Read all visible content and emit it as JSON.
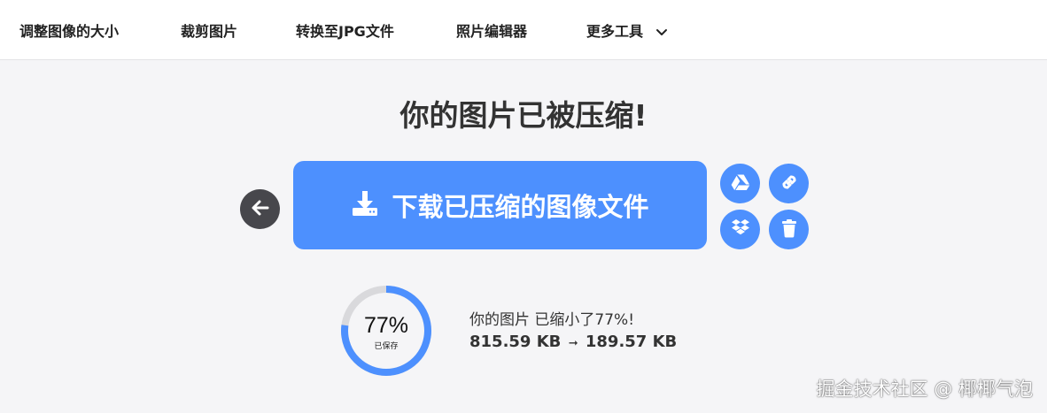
{
  "nav": {
    "items": [
      {
        "label": "调整图像的大小"
      },
      {
        "label": "裁剪图片"
      },
      {
        "label": "转换至JPG文件"
      },
      {
        "label": "照片编辑器"
      },
      {
        "label": "更多工具"
      }
    ],
    "more_icon": "chevron-down-icon"
  },
  "main": {
    "headline": "你的图片已被压缩!",
    "download_label": "下载已压缩的图像文件",
    "download_icon": "download-tray-icon",
    "back_icon": "arrow-left-icon",
    "actions": [
      {
        "icon": "google-drive-icon"
      },
      {
        "icon": "link-icon"
      },
      {
        "icon": "dropbox-icon"
      },
      {
        "icon": "trash-icon"
      }
    ]
  },
  "result": {
    "percent_saved_label": "77%",
    "percent_saved_value": 0.77,
    "saved_label": "已保存",
    "message": "你的图片 已缩小了77%!",
    "original_size": "815.59 KB",
    "arrow": "➞",
    "compressed_size": "189.57 KB"
  },
  "watermark": "掘金技术社区 @ 椰椰气泡",
  "colors": {
    "accent": "#4d90fe",
    "back_button": "#47474c",
    "ring_track": "#d9d9dc",
    "background": "#f5f5f7"
  }
}
